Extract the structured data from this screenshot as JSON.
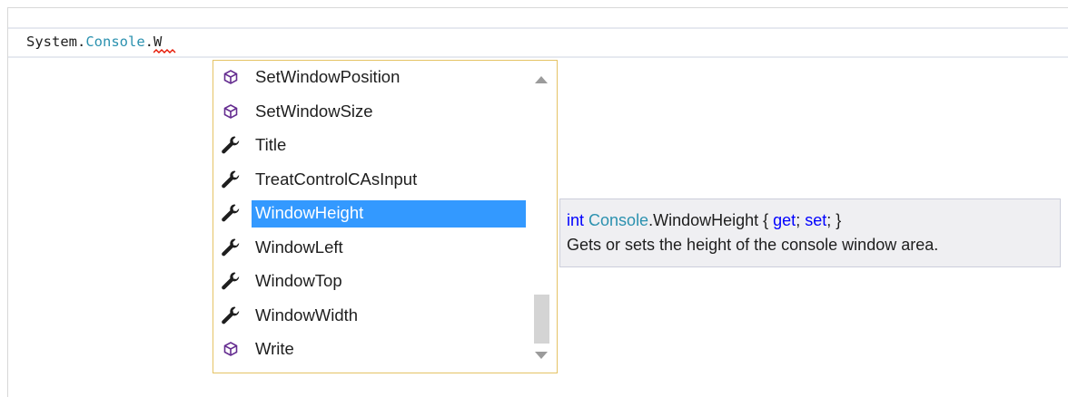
{
  "editor": {
    "code": {
      "namespace": "System",
      "dot1": ".",
      "type": "Console",
      "dot2": ".",
      "typed": "W"
    }
  },
  "completion": {
    "items": [
      {
        "label": "SetWindowPosition",
        "icon": "method-icon",
        "selected": false
      },
      {
        "label": "SetWindowSize",
        "icon": "method-icon",
        "selected": false
      },
      {
        "label": "Title",
        "icon": "property-wrench-icon",
        "selected": false
      },
      {
        "label": "TreatControlCAsInput",
        "icon": "property-wrench-icon",
        "selected": false
      },
      {
        "label": "WindowHeight",
        "icon": "property-wrench-icon",
        "selected": true
      },
      {
        "label": "WindowLeft",
        "icon": "property-wrench-icon",
        "selected": false
      },
      {
        "label": "WindowTop",
        "icon": "property-wrench-icon",
        "selected": false
      },
      {
        "label": "WindowWidth",
        "icon": "property-wrench-icon",
        "selected": false
      },
      {
        "label": "Write",
        "icon": "method-icon",
        "selected": false
      }
    ],
    "selection_color": "#3399ff",
    "border_color": "#e5c365"
  },
  "tooltip": {
    "return_type": "int",
    "declaring_type": "Console",
    "member": ".WindowHeight { ",
    "get": "get",
    "sep": "; ",
    "set": "set",
    "close": "; }",
    "description": "Gets or sets the height of the console window area."
  }
}
